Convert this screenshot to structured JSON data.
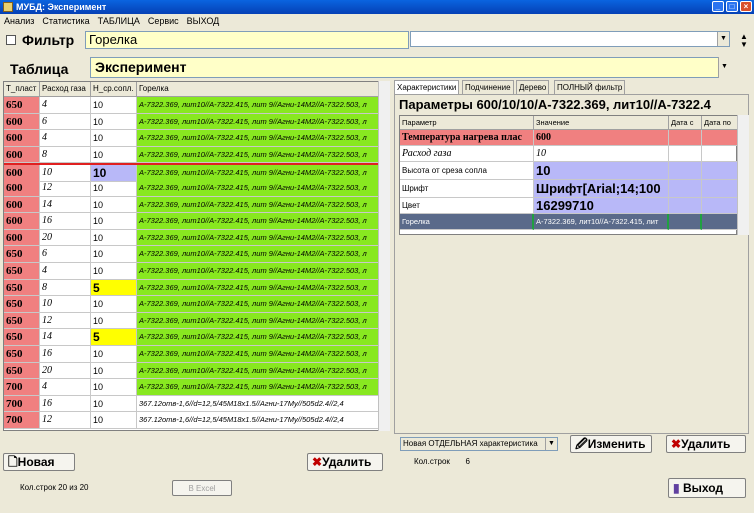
{
  "window": {
    "title": "МУБД: Эксперимент"
  },
  "menu": [
    "Анализ",
    "Статистика",
    "ТАБЛИЦА",
    "Сервис",
    "ВЫХОД"
  ],
  "filter": {
    "label": "Фильтр",
    "value": "Горелка",
    "combo_value": ""
  },
  "table": {
    "label": "Таблица",
    "value": "Эксперимент"
  },
  "grid": {
    "columns": [
      "T_пласт",
      "Расход газа",
      "H_ср.сопл.",
      "Горелка"
    ],
    "rows": [
      [
        "650",
        "4",
        "10",
        "А-7322.369, лит10//А-7322.415, лит 9//Агни-14М2//А-7322.503, л"
      ],
      [
        "600",
        "6",
        "10",
        "А-7322.369, лит10//А-7322.415, лит 9//Агни-14М2//А-7322.503, л"
      ],
      [
        "600",
        "4",
        "10",
        "А-7322.369, лит10//А-7322.415, лит 9//Агни-14М2//А-7322.503, л"
      ],
      [
        "600",
        "8",
        "10",
        "А-7322.369, лит10//А-7322.415, лит 9//Агни-14М2//А-7322.503, л"
      ],
      [
        "600",
        "10",
        "10",
        "А-7322.369, лит10//А-7322.415, лит 9//Агни-14М2//А-7322.503, л"
      ],
      [
        "600",
        "12",
        "10",
        "А-7322.369, лит10//А-7322.415, лит 9//Агни-14М2//А-7322.503, л"
      ],
      [
        "600",
        "14",
        "10",
        "А-7322.369, лит10//А-7322.415, лит 9//Агни-14М2//А-7322.503, л"
      ],
      [
        "600",
        "16",
        "10",
        "А-7322.369, лит10//А-7322.415, лит 9//Агни-14М2//А-7322.503, л"
      ],
      [
        "600",
        "20",
        "10",
        "А-7322.369, лит10//А-7322.415, лит 9//Агни-14М2//А-7322.503, л"
      ],
      [
        "650",
        "6",
        "10",
        "А-7322.369, лит10//А-7322.415, лит 9//Агни-14М2//А-7322.503, л"
      ],
      [
        "650",
        "4",
        "10",
        "А-7322.369, лит10//А-7322.415, лит 9//Агни-14М2//А-7322.503, л"
      ],
      [
        "650",
        "8",
        "5",
        "А-7322.369, лит10//А-7322.415, лит 9//Агни-14М2//А-7322.503, л"
      ],
      [
        "650",
        "10",
        "10",
        "А-7322.369, лит10//А-7322.415, лит 9//Агни-14М2//А-7322.503, л"
      ],
      [
        "650",
        "12",
        "10",
        "А-7322.369, лит10//А-7322.415, лит 9//Агни-14М2//А-7322.503, л"
      ],
      [
        "650",
        "14",
        "5",
        "А-7322.369, лит10//А-7322.415, лит 9//Агни-14М2//А-7322.503, л"
      ],
      [
        "650",
        "16",
        "10",
        "А-7322.369, лит10//А-7322.415, лит 9//Агни-14М2//А-7322.503, л"
      ],
      [
        "650",
        "20",
        "10",
        "А-7322.369, лит10//А-7322.415, лит 9//Агни-14М2//А-7322.503, л"
      ],
      [
        "700",
        "4",
        "10",
        "А-7322.369, лит10//А-7322.415, лит 9//Агни-14М2//А-7322.503, л"
      ],
      [
        "700",
        "16",
        "10",
        "367.12отв-1,6//d=12,5/45М18х1.5//Агни-17Му//505d2.4//2,4"
      ],
      [
        "700",
        "12",
        "10",
        "367.12отв-1,6//d=12,5/45М18х1.5//Агни-17Му//505d2.4//2,4"
      ]
    ]
  },
  "buttons": {
    "new": "Новая",
    "delete_left": "Удалить",
    "edit": "Изменить",
    "delete_right": "Удалить",
    "excel": "В Excel",
    "exit": "Выход"
  },
  "tabs": [
    "Характеристики",
    "Подчинение",
    "Дерево",
    "ПОЛНЫЙ фильтр"
  ],
  "params": {
    "title": "Параметры 600/10/10/А-7322.369, лит10//А-7322.4",
    "columns": [
      "Параметр",
      "Значение",
      "Дата с",
      "Дата по"
    ],
    "rows": [
      [
        "Температура нагрева плас",
        "600"
      ],
      [
        "Расход газа",
        "10"
      ],
      [
        "Высота от среза сопла",
        "10"
      ],
      [
        "Шрифт",
        "Шрифт[Arial;14;100"
      ],
      [
        "Цвет",
        "16299710"
      ],
      [
        "Горелка",
        "А-7322.369, лит10//А-7322.415, лит"
      ]
    ]
  },
  "right_bottom": {
    "combo": "Новая ОТДЕЛЬНАЯ характеристика",
    "count_label": "Кол.строк",
    "count_value": "6"
  },
  "footer": {
    "count_label": "Кол.строк",
    "count_value": "20 из 20"
  },
  "colors": {
    "pink": "#f08080",
    "green": "#88e820",
    "yellow": "#ffff00",
    "lavender": "#b8b8f8",
    "selected": "#5a6a8a"
  }
}
